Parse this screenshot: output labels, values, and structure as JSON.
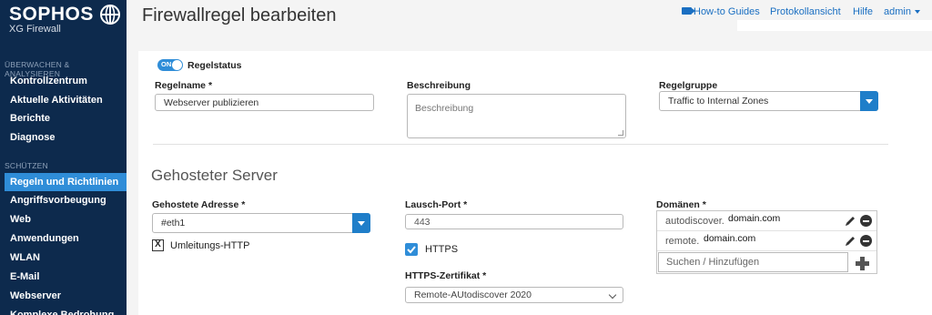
{
  "sidebar": {
    "brand": "SOPHOS",
    "product": "XG Firewall",
    "sections": [
      {
        "title": "ÜBERWACHEN & ANALYSIEREN",
        "items": [
          "Kontrollzentrum",
          "Aktuelle Aktivitäten",
          "Berichte",
          "Diagnose"
        ]
      },
      {
        "title": "SCHÜTZEN",
        "items": [
          "Regeln und Richtlinien",
          "Angriffsvorbeugung",
          "Web",
          "Anwendungen",
          "WLAN",
          "E-Mail",
          "Webserver",
          "Komplexe Bedrohung"
        ]
      }
    ],
    "active_item": "Regeln und Richtlinien"
  },
  "header": {
    "title": "Firewallregel bearbeiten",
    "links": {
      "howto": "How-to Guides",
      "log": "Protokollansicht",
      "help": "Hilfe",
      "user": "admin"
    }
  },
  "form": {
    "status": {
      "toggle_text": "ON",
      "label": "Regelstatus",
      "enabled": true
    },
    "rule_name": {
      "label": "Regelname *",
      "value": "Webserver publizieren"
    },
    "description": {
      "label": "Beschreibung",
      "placeholder": "Beschreibung"
    },
    "rule_group": {
      "label": "Regelgruppe",
      "value": "Traffic to Internal Zones"
    },
    "hosted_server_heading": "Gehosteter Server",
    "hosted_address": {
      "label": "Gehostete Adresse *",
      "value": "#eth1"
    },
    "redirect_http": {
      "label": "Umleitungs-HTTP",
      "checked": true,
      "mark": "X"
    },
    "listen_port": {
      "label": "Lausch-Port *",
      "value": "443"
    },
    "https": {
      "label": "HTTPS",
      "checked": true
    },
    "https_cert": {
      "label": "HTTPS-Zertifikat *",
      "value": "Remote-AUtodiscover 2020"
    },
    "domains": {
      "label": "Domänen *",
      "entries": [
        {
          "prefix": "autodiscover.",
          "suffix": "domain.com"
        },
        {
          "prefix": "remote.",
          "suffix": "domain.com"
        }
      ],
      "search_placeholder": "Suchen / Hinzufügen"
    }
  },
  "colors": {
    "sidebar_bg": "#0d2a4d",
    "active_item": "#2f8dd8",
    "link": "#1a6fc2",
    "dropdown_button": "#1f7ec9"
  }
}
